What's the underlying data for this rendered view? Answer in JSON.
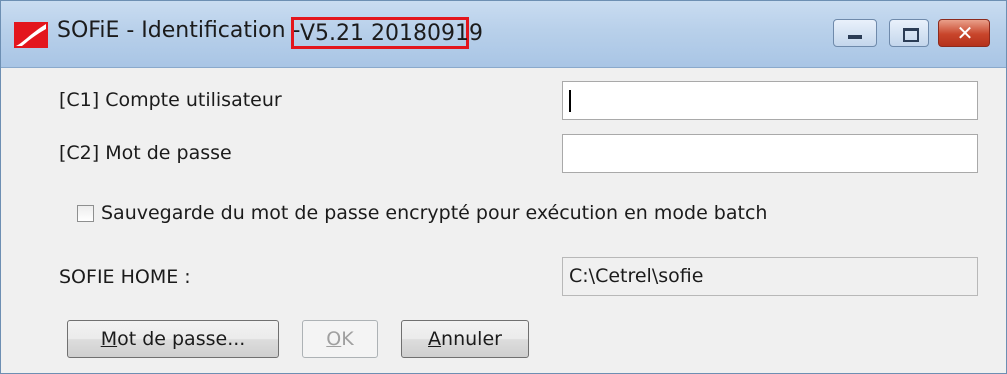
{
  "window": {
    "title": "SOFiE - Identification -",
    "version": "V5.21 20180919",
    "controls": {
      "minimize": "minimize",
      "maximize": "maximize",
      "close": "close"
    },
    "accent_colors": {
      "titlebar": "#b8d0ea",
      "version_highlight": "#e3161d",
      "close": "#c8452b",
      "logo": "#e3161d"
    }
  },
  "form": {
    "user_account": {
      "label": "[C1]  Compte utilisateur",
      "value": ""
    },
    "password": {
      "label": "[C2]  Mot de passe",
      "value": ""
    },
    "save_password_checkbox": {
      "label": "Sauvegarde du mot de passe encrypté pour exécution en mode batch",
      "checked": false
    },
    "sofie_home": {
      "label": "SOFIE HOME :",
      "value": "C:\\Cetrel\\sofie"
    }
  },
  "buttons": {
    "password": {
      "accel": "M",
      "rest": "ot de passe..."
    },
    "ok": {
      "accel": "O",
      "rest": "K",
      "enabled": false
    },
    "cancel": {
      "accel": "A",
      "rest": "nnuler"
    }
  }
}
